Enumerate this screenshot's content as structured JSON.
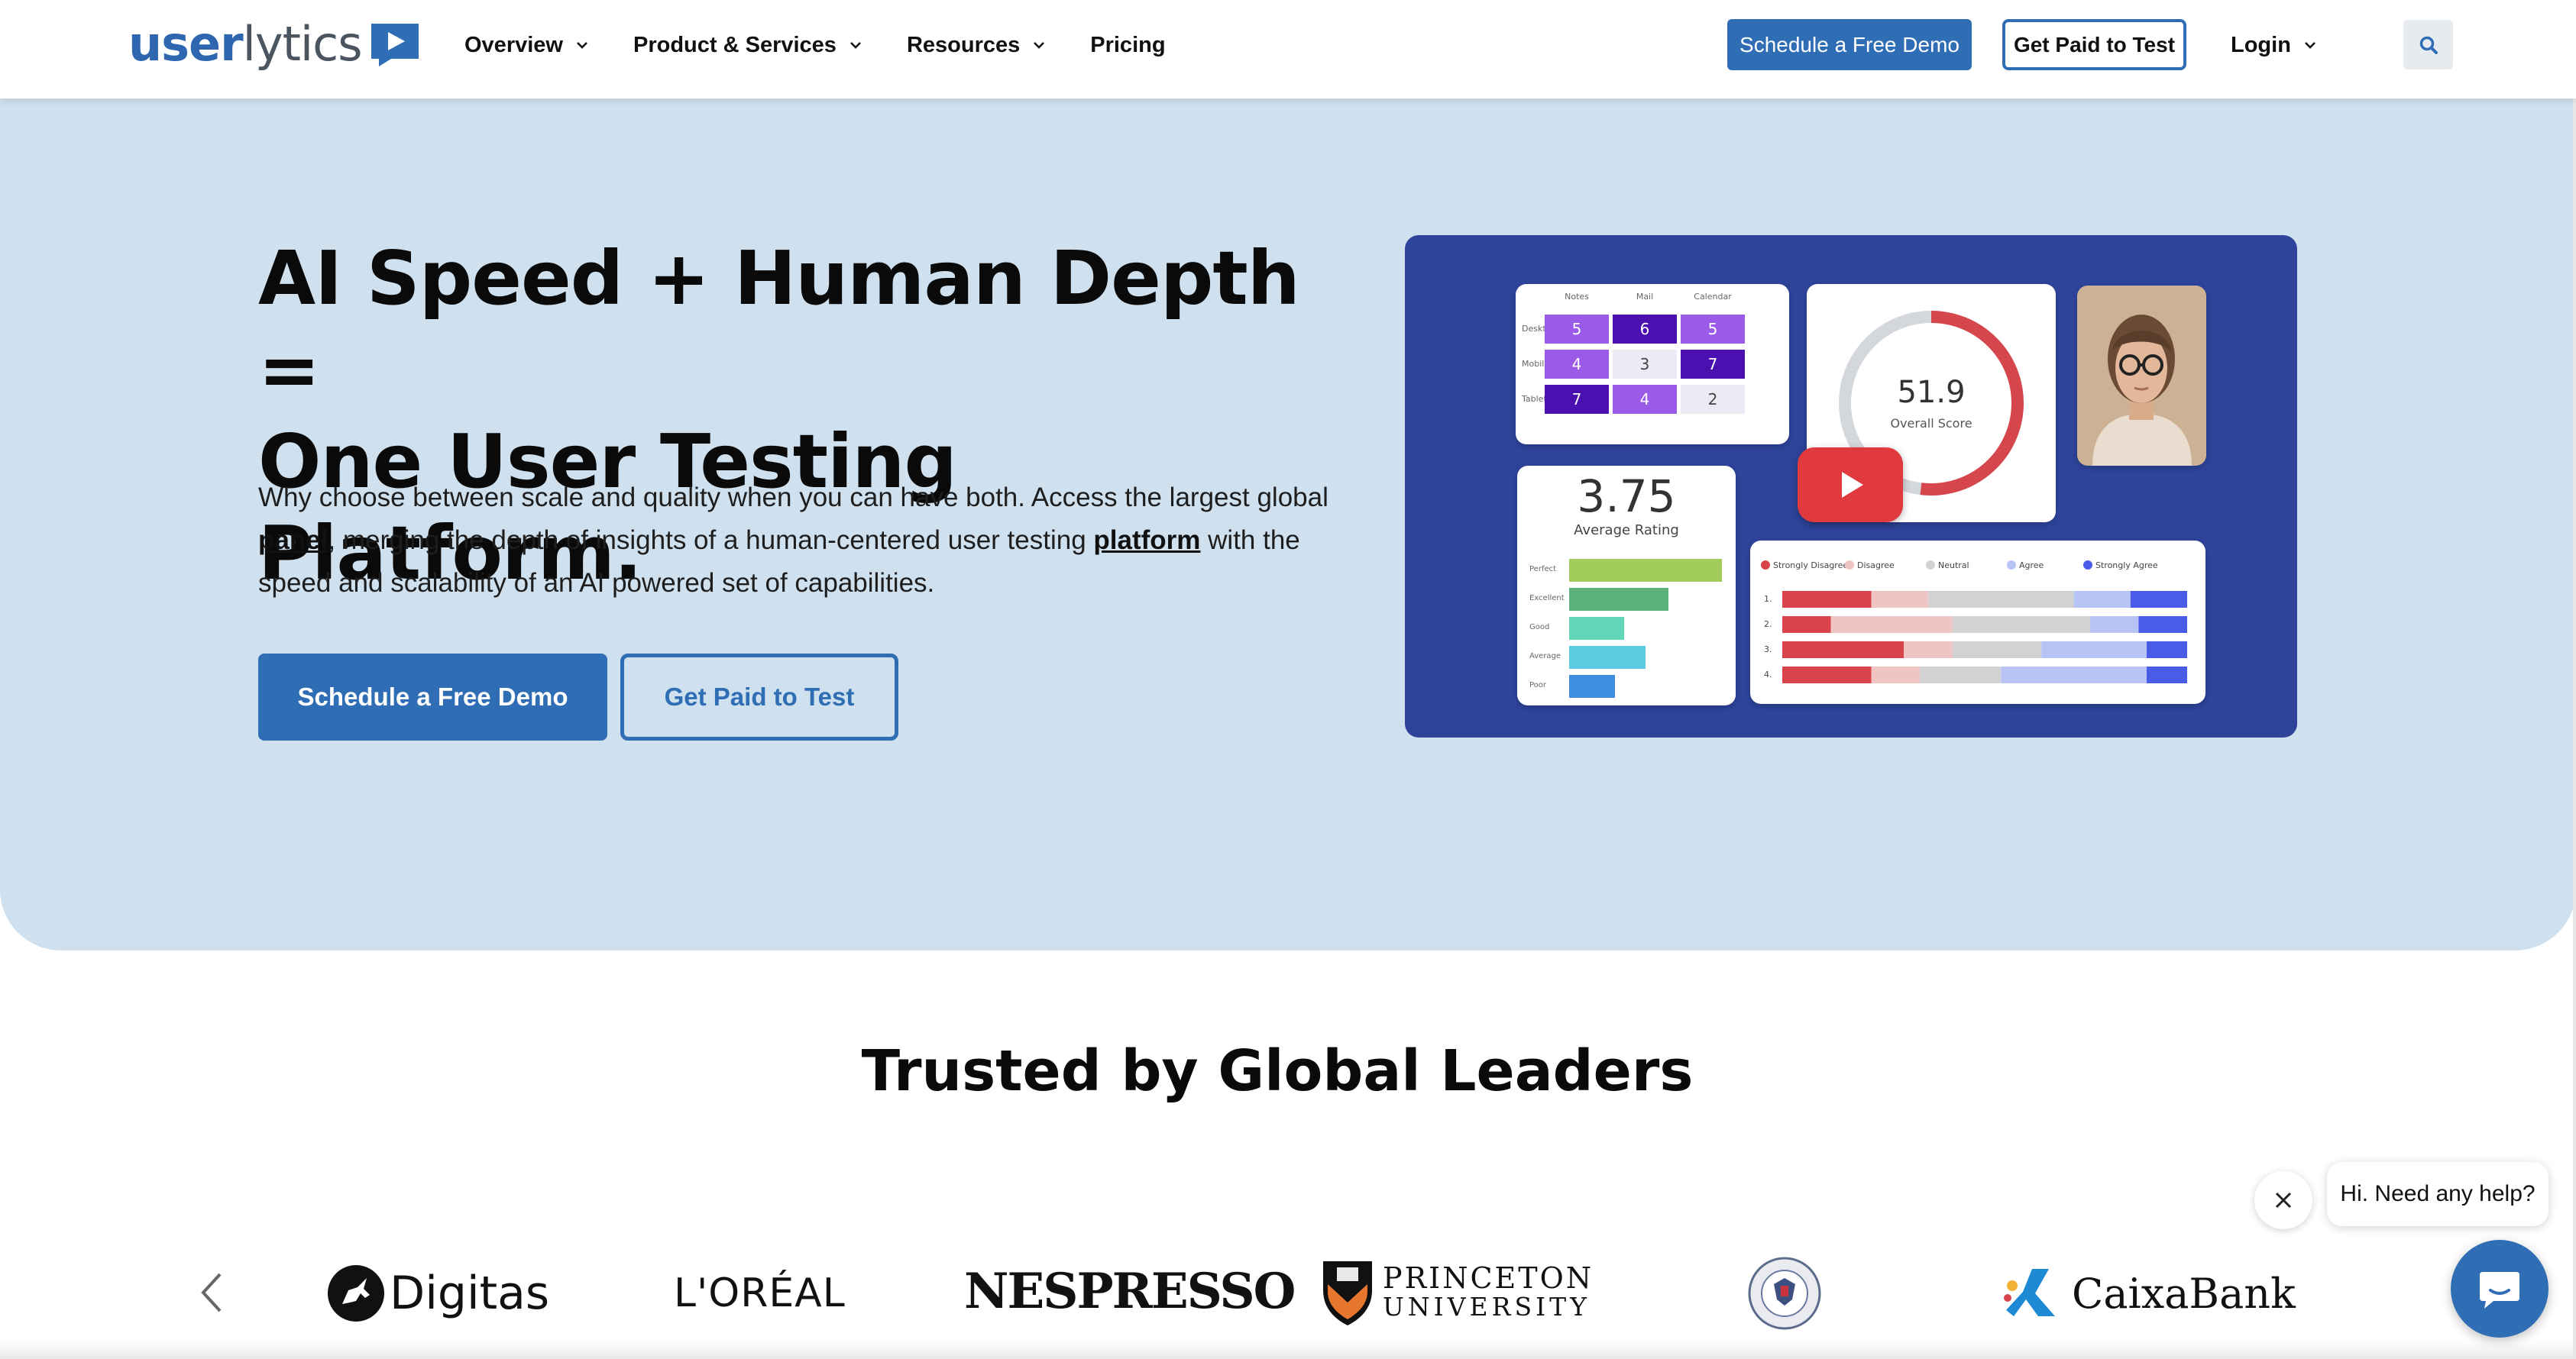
{
  "header": {
    "logo_text_a": "user",
    "logo_text_b": "lytics",
    "nav": [
      {
        "label": "Overview",
        "has_dropdown": true
      },
      {
        "label": "Product & Services",
        "has_dropdown": true
      },
      {
        "label": "Resources",
        "has_dropdown": true
      },
      {
        "label": "Pricing",
        "has_dropdown": false
      }
    ],
    "demo_button": "Schedule a Free Demo",
    "paid_button": "Get Paid to Test",
    "login": "Login"
  },
  "hero": {
    "title_line1": "AI Speed + Human Depth =",
    "title_line2": "One User Testing Platform.",
    "desc_part1": "Why choose between scale and quality when you can have both. Access the largest global",
    "desc_link1": "panel",
    "desc_part2": ", merging the depth of insights of a human-centered user testing",
    "desc_link2": "platform",
    "desc_part3": "with the speed and scalability of an AI powered set of capabilities.",
    "demo_button": "Schedule a Free Demo",
    "paid_button": "Get Paid to Test"
  },
  "video": {
    "grid": {
      "columns": [
        "Notes",
        "Mail",
        "Calendar"
      ],
      "rows": [
        {
          "label": "Desktop",
          "values": [
            "5",
            "6",
            "5"
          ]
        },
        {
          "label": "Mobile",
          "values": [
            "4",
            "3",
            "7"
          ]
        },
        {
          "label": "Tablet",
          "values": [
            "7",
            "4",
            "2"
          ]
        }
      ]
    },
    "score_value": "51.9",
    "score_label": "Overall Score",
    "score_fraction": 0.519,
    "rating_value": "3.75",
    "rating_label": "Average Rating",
    "rating_rows": [
      {
        "label": "Perfect",
        "fraction": 1.0,
        "color": "#a2cc5c"
      },
      {
        "label": "Excellent",
        "fraction": 0.65,
        "color": "#5ab27a"
      },
      {
        "label": "Good",
        "fraction": 0.36,
        "color": "#62d6b8"
      },
      {
        "label": "Average",
        "fraction": 0.5,
        "color": "#5bcbe0"
      },
      {
        "label": "Poor",
        "fraction": 0.3,
        "color": "#3f8de0"
      }
    ],
    "likert_legend": [
      "Strongly Disagree",
      "Disagree",
      "Neutral",
      "Agree",
      "Strongly Agree"
    ],
    "likert_colors": [
      "#d9434a",
      "#f1c4c4",
      "#d2d2d2",
      "#b7c4f5",
      "#4a5be8"
    ],
    "likert_rows": [
      {
        "label": "1.",
        "parts": [
          0.22,
          0.14,
          0.36,
          0.14,
          0.14
        ]
      },
      {
        "label": "2.",
        "parts": [
          0.12,
          0.3,
          0.34,
          0.12,
          0.12
        ]
      },
      {
        "label": "3.",
        "parts": [
          0.3,
          0.12,
          0.22,
          0.26,
          0.1
        ]
      },
      {
        "label": "4.",
        "parts": [
          0.22,
          0.12,
          0.2,
          0.36,
          0.1
        ]
      }
    ]
  },
  "trusted": {
    "title": "Trusted by Global Leaders",
    "logos": [
      "Digitas",
      "L'ORÉAL",
      "NESPRESSO",
      "PRINCETON",
      "UNIVERSITY",
      "CaixaBank"
    ]
  },
  "chat": {
    "message": "Hi. Need any help?"
  },
  "colors": {
    "brand_blue": "#2f6db5",
    "hero_bg": "#cfe0ee",
    "video_bg": "#2e449b",
    "play_red": "#e0393e"
  }
}
